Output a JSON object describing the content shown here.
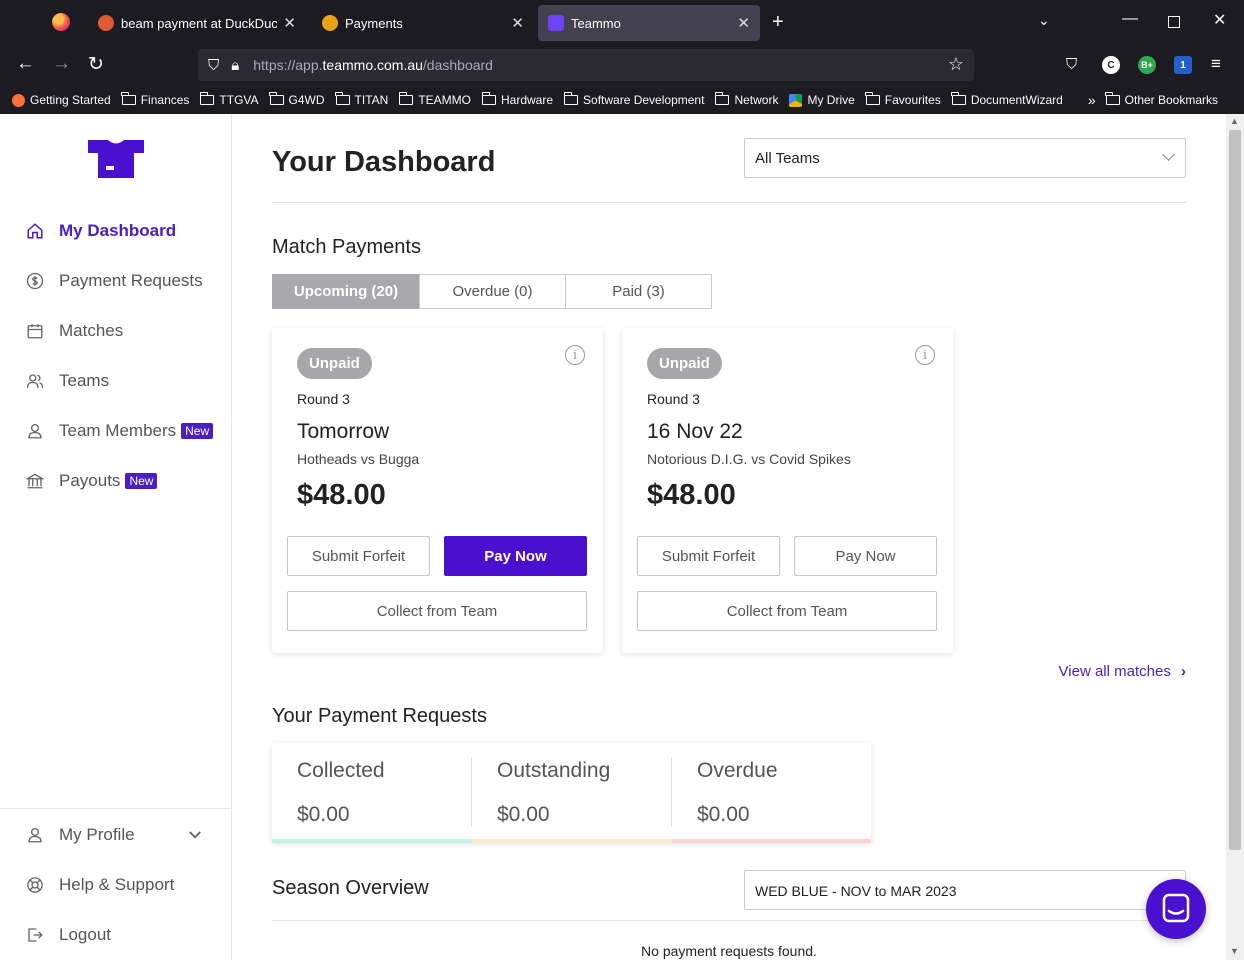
{
  "browser": {
    "tabs": [
      {
        "title": "beam payment at DuckDuckGo",
        "favicon_color": "#de5833"
      },
      {
        "title": "Payments",
        "favicon_color": "#e8a317"
      },
      {
        "title": "Teammo",
        "favicon_color": "#6d43f5"
      }
    ],
    "url_prefix": "https://app.",
    "url_domain": "teammo.com.au",
    "url_path": "/dashboard",
    "bookmarks": [
      "Getting Started",
      "Finances",
      "TTGVA",
      "G4WD",
      "TITAN",
      "TEAMMO",
      "Hardware",
      "Software Development",
      "Network",
      "My Drive",
      "Favourites",
      "DocumentWizard"
    ],
    "other_bookmarks": "Other Bookmarks",
    "extension_labels": [
      "C",
      "B+",
      "1"
    ]
  },
  "sidebar": {
    "items": [
      {
        "label": "My Dashboard",
        "icon": "home-icon"
      },
      {
        "label": "Payment Requests",
        "icon": "dollar-circle-icon"
      },
      {
        "label": "Matches",
        "icon": "calendar-icon"
      },
      {
        "label": "Teams",
        "icon": "users-icon"
      },
      {
        "label": "Team Members",
        "icon": "user-icon",
        "badge": "New"
      },
      {
        "label": "Payouts",
        "icon": "bank-icon",
        "badge": "New"
      }
    ],
    "bottom": [
      {
        "label": "My Profile",
        "icon": "user-icon"
      },
      {
        "label": "Help & Support",
        "icon": "lifebuoy-icon"
      },
      {
        "label": "Logout",
        "icon": "logout-icon"
      }
    ]
  },
  "main": {
    "title": "Your Dashboard",
    "team_select": "All Teams",
    "match_payments": {
      "heading": "Match Payments",
      "tabs": [
        "Upcoming (20)",
        "Overdue (0)",
        "Paid (3)"
      ],
      "cards": [
        {
          "status": "Unpaid",
          "round": "Round 3",
          "when": "Tomorrow",
          "teams": "Hotheads vs Bugga",
          "amount": "$48.00",
          "forfeit": "Submit Forfeit",
          "pay": "Pay Now",
          "collect": "Collect from Team"
        },
        {
          "status": "Unpaid",
          "round": "Round 3",
          "when": "16 Nov 22",
          "teams": "Notorious D.I.G. vs Covid Spikes",
          "amount": "$48.00",
          "forfeit": "Submit Forfeit",
          "pay": "Pay Now",
          "collect": "Collect from Team"
        }
      ],
      "view_all": "View all matches"
    },
    "payment_requests": {
      "heading": "Your Payment Requests",
      "stats": [
        {
          "label": "Collected",
          "value": "$0.00",
          "color": "#c8f3e3"
        },
        {
          "label": "Outstanding",
          "value": "$0.00",
          "color": "#fbeed0"
        },
        {
          "label": "Overdue",
          "value": "$0.00",
          "color": "#fad5d5"
        }
      ]
    },
    "season_overview": {
      "heading": "Season Overview",
      "select": "WED BLUE - NOV to MAR 2023",
      "empty": "No payment requests found."
    }
  },
  "colors": {
    "brand": "#4a10d0",
    "active_nav": "#4a1ec4"
  }
}
